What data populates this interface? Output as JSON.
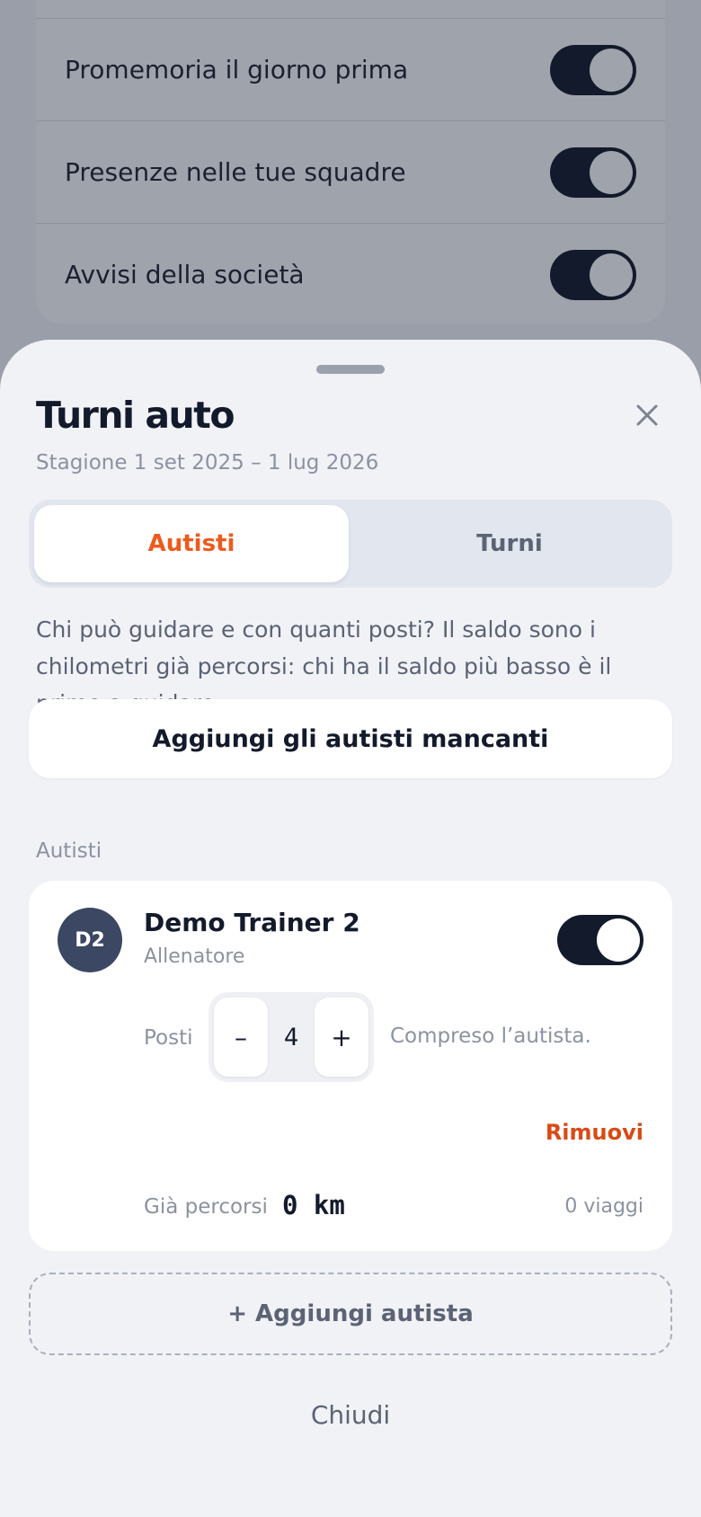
{
  "background_settings": {
    "rows": [
      {
        "label": "Promemoria il giorno prima",
        "enabled": true
      },
      {
        "label": "Presenze nelle tue squadre",
        "enabled": true
      },
      {
        "label": "Avvisi della società",
        "enabled": true
      }
    ]
  },
  "sheet": {
    "title": "Turni auto",
    "subtitle": "Stagione 1 set 2025 – 1 lug 2026",
    "close_icon": "close-icon",
    "tabs": [
      {
        "label": "Autisti",
        "active": true
      },
      {
        "label": "Turni",
        "active": false
      }
    ],
    "description": "Chi può guidare e con quanti posti? Il saldo sono i chilometri già percorsi: chi ha il saldo più basso è il primo a guidare.",
    "add_missing_label": "Aggiungi gli autisti mancanti",
    "section_label": "Autisti",
    "drivers": [
      {
        "initials": "D2",
        "name": "Demo Trainer 2",
        "role": "Allenatore",
        "enabled": true,
        "seats_label": "Posti",
        "seats_minus": "–",
        "seats_value": "4",
        "seats_plus": "+",
        "seats_hint": "Compreso l’autista.",
        "remove_label": "Rimuovi",
        "distance_label": "Già percorsi",
        "distance_value": "0 km",
        "trips": "0 viaggi"
      }
    ],
    "add_driver_label": "+ Aggiungi autista",
    "close_label": "Chiudi"
  },
  "colors": {
    "accent": "#ee5a1e",
    "danger": "#d94a16",
    "dark": "#131a2b",
    "avatar": "#3b4763"
  }
}
